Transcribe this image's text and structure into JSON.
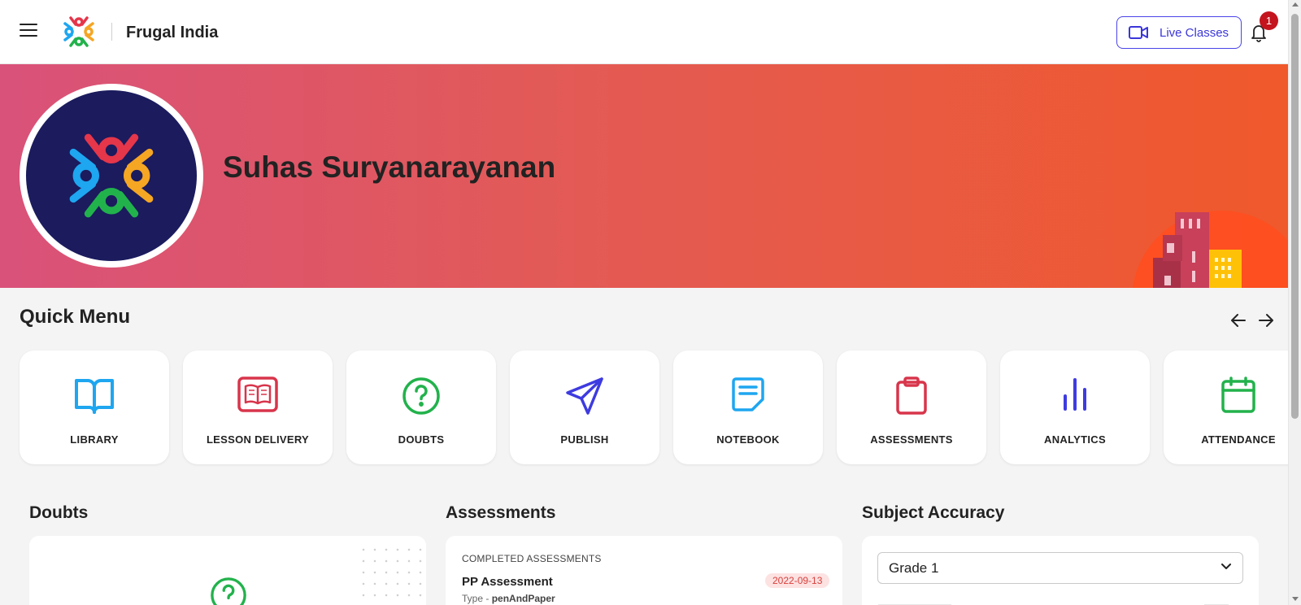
{
  "header": {
    "brand_name": "Frugal India",
    "live_classes_label": "Live Classes",
    "notification_count": "1"
  },
  "banner": {
    "user_name": "Suhas Suryanarayanan"
  },
  "quick_menu": {
    "title": "Quick Menu",
    "items": [
      {
        "label": "LIBRARY",
        "icon": "book-open-icon",
        "color": "#1ea6f0"
      },
      {
        "label": "LESSON DELIVERY",
        "icon": "lesson-book-icon",
        "color": "#d8354b"
      },
      {
        "label": "DOUBTS",
        "icon": "question-circle-icon",
        "color": "#22b24c"
      },
      {
        "label": "PUBLISH",
        "icon": "send-icon",
        "color": "#3e3be0"
      },
      {
        "label": "NOTEBOOK",
        "icon": "notebook-icon",
        "color": "#1ea6f0"
      },
      {
        "label": "ASSESSMENTS",
        "icon": "clipboard-icon",
        "color": "#d8354b"
      },
      {
        "label": "ANALYTICS",
        "icon": "bar-chart-icon",
        "color": "#3e3be0"
      },
      {
        "label": "ATTENDANCE",
        "icon": "calendar-icon",
        "color": "#22b24c"
      }
    ]
  },
  "doubts": {
    "title": "Doubts"
  },
  "assessments": {
    "title": "Assessments",
    "section_label": "COMPLETED ASSESSMENTS",
    "item": {
      "name": "PP Assessment",
      "type_prefix": "Type - ",
      "type_value": "penAndPaper",
      "date": "2022-09-13"
    }
  },
  "subject_accuracy": {
    "title": "Subject Accuracy",
    "selected_grade": "Grade 1"
  },
  "colors": {
    "accent": "#3b36d9",
    "badge": "#c4141d",
    "banner_start": "#d9527a",
    "banner_end": "#f0592b",
    "avatar_bg": "#1b1b5e"
  }
}
